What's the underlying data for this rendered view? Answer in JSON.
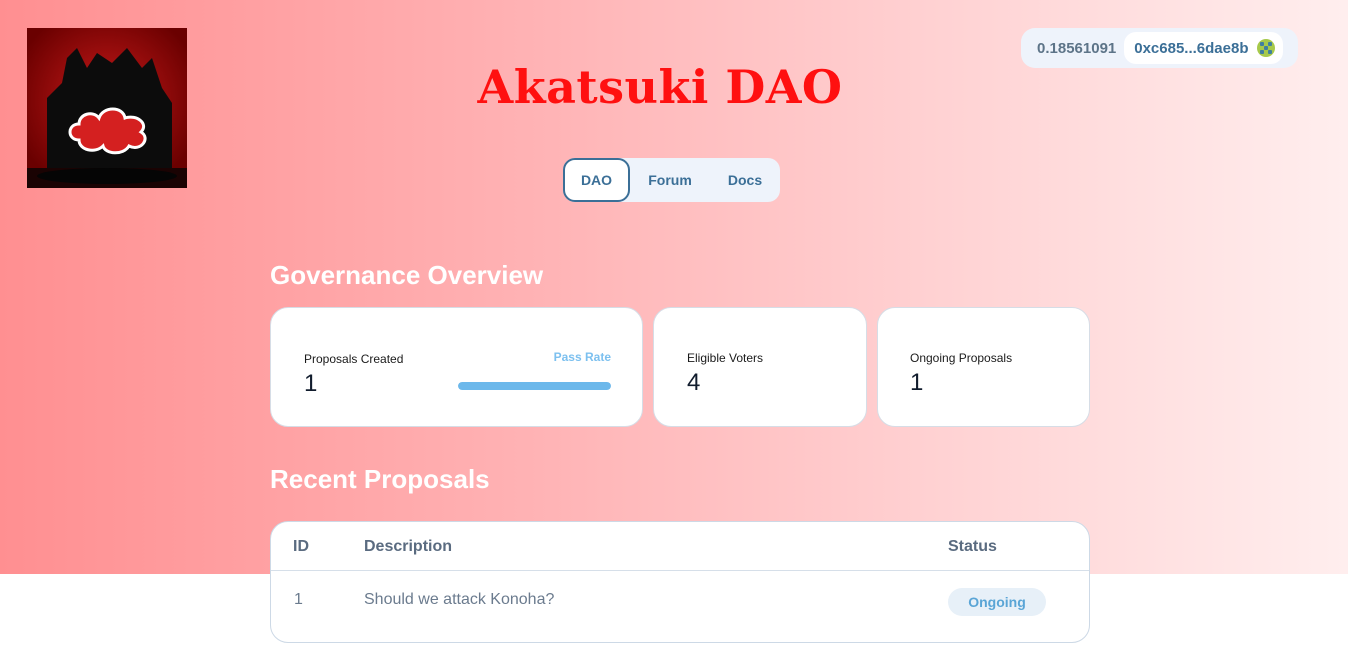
{
  "header": {
    "title": "Akatsuki DAO",
    "logo_icon": "akatsuki-cloud-logo"
  },
  "wallet": {
    "balance": "0.18561091",
    "address": "0xc685...6dae8b",
    "avatar_icon": "identicon-avatar"
  },
  "nav": {
    "tabs": [
      {
        "label": "DAO",
        "active": true
      },
      {
        "label": "Forum",
        "active": false
      },
      {
        "label": "Docs",
        "active": false
      }
    ]
  },
  "overview": {
    "title": "Governance Overview",
    "proposals_created_label": "Proposals Created",
    "proposals_created_value": "1",
    "pass_rate_label": "Pass Rate",
    "pass_rate_fraction": 1.0,
    "eligible_voters_label": "Eligible Voters",
    "eligible_voters_value": "4",
    "ongoing_label": "Ongoing Proposals",
    "ongoing_value": "1"
  },
  "proposals": {
    "title": "Recent Proposals",
    "columns": [
      "ID",
      "Description",
      "Status"
    ],
    "rows": [
      {
        "id": "1",
        "description": "Should we attack Konoha?",
        "status": "Ongoing"
      }
    ]
  },
  "colors": {
    "title_red": "#ff1010",
    "accent_blue": "#3b6f97",
    "pass_bar": "#6cb8eb"
  }
}
